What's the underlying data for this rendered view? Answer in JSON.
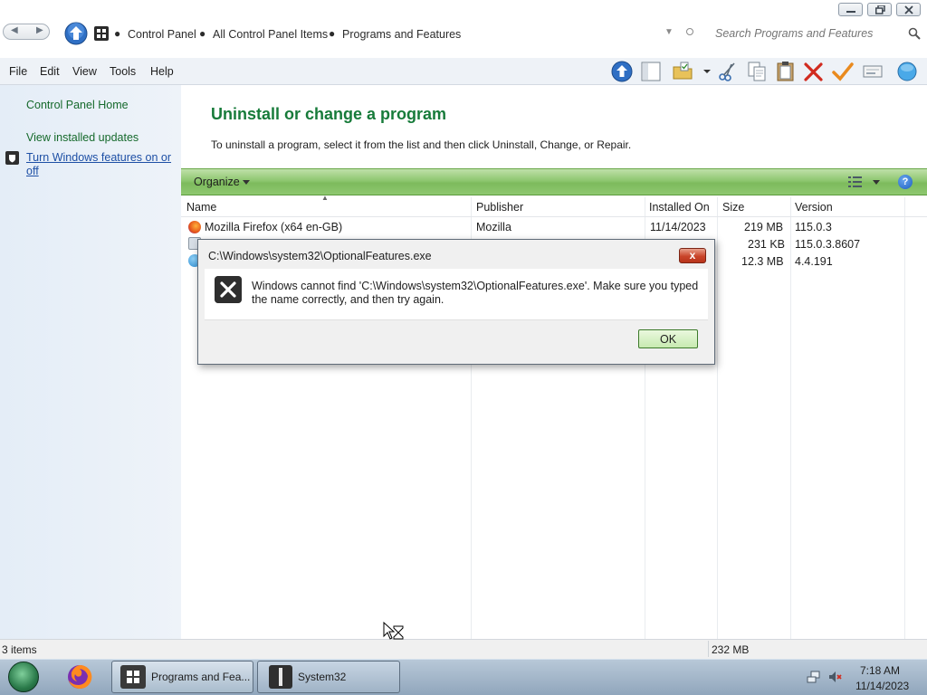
{
  "window": {
    "caption_buttons": [
      "minimize",
      "restore",
      "close"
    ]
  },
  "address": {
    "breadcrumb": [
      "Control Panel",
      "All Control Panel Items",
      "Programs and Features"
    ],
    "search_placeholder": "Search Programs and Features"
  },
  "menu": [
    "File",
    "Edit",
    "View",
    "Tools",
    "Help"
  ],
  "toolbar_icons": [
    "up-icon",
    "pane-icon",
    "folder-icon",
    "cut-icon",
    "copy-icon",
    "paste-icon",
    "delete-icon",
    "check-icon",
    "rename-icon",
    "globe-icon"
  ],
  "sidebar": {
    "items": [
      {
        "label": "Control Panel Home"
      },
      {
        "label": "View installed updates"
      },
      {
        "label": "Turn Windows features on or off",
        "icon": "shield-icon"
      }
    ]
  },
  "main": {
    "title": "Uninstall or change a program",
    "description": "To uninstall a program, select it from the list and then click Uninstall, Change, or Repair.",
    "organize_label": "Organize",
    "help_label": "?"
  },
  "table": {
    "columns": [
      "Name",
      "Publisher",
      "Installed On",
      "Size",
      "Version"
    ],
    "rows": [
      {
        "name": "Mozilla Firefox (x64 en-GB)",
        "publisher": "Mozilla",
        "installed_on": "11/14/2023",
        "size": "219 MB",
        "version": "115.0.3"
      },
      {
        "name": "",
        "publisher": "",
        "installed_on": "",
        "size": "231 KB",
        "version": "115.0.3.8607"
      },
      {
        "name": "",
        "publisher": "",
        "installed_on": "",
        "size": "12.3 MB",
        "version": "4.4.191"
      }
    ]
  },
  "dialog": {
    "title": "C:\\Windows\\system32\\OptionalFeatures.exe",
    "close_label": "x",
    "message": "Windows cannot find 'C:\\Windows\\system32\\OptionalFeatures.exe'. Make sure you typed the name correctly, and then try again.",
    "ok_label": "OK"
  },
  "status": {
    "items_count": "3 items",
    "total_size": "232 MB"
  },
  "taskbar": {
    "tasks": [
      {
        "label": "Programs and Fea..."
      },
      {
        "label": "System32"
      }
    ],
    "time": "7:18 AM",
    "date": "11/14/2023"
  }
}
